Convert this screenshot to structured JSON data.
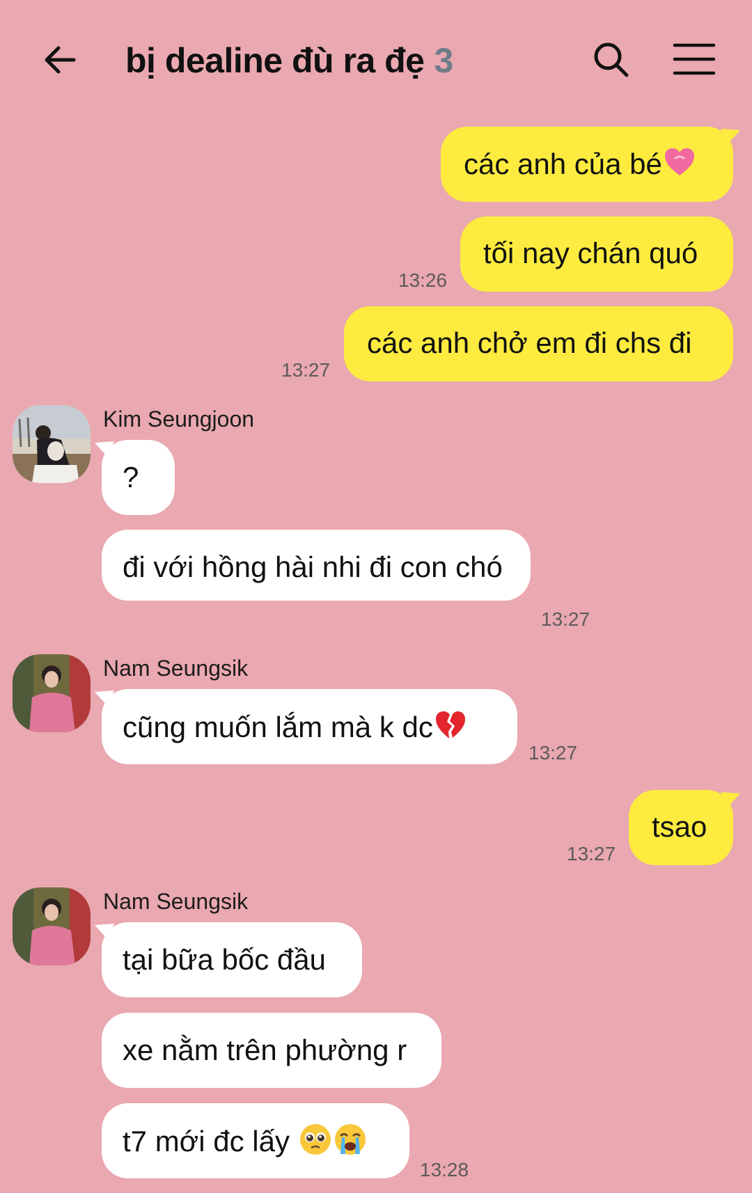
{
  "header": {
    "title": "bị dealine đù ra đẹ",
    "member_count": "3"
  },
  "messages": [
    {
      "from": "me",
      "text": "các anh của bé",
      "emoji": "pink-heart"
    },
    {
      "from": "me",
      "text": "tối nay chán quó",
      "time": "13:26"
    },
    {
      "from": "me",
      "text": "các anh chở em đi chs đi",
      "time": "13:27"
    },
    {
      "from": "them",
      "sender": "Kim Seungjoon",
      "text": "?"
    },
    {
      "from": "them",
      "text": "đi với hồng hài nhi đi con chó",
      "time": "13:27"
    },
    {
      "from": "them",
      "sender": "Nam Seungsik",
      "text": "cũng muốn lắm mà k dc",
      "emoji": "broken-heart",
      "time": "13:27"
    },
    {
      "from": "me",
      "text": "tsao",
      "time": "13:27"
    },
    {
      "from": "them",
      "sender": "Nam Seungsik",
      "text": "tại bữa bốc đầu"
    },
    {
      "from": "them",
      "text": "xe nằm trên phường r"
    },
    {
      "from": "them",
      "text": "t7 mới đc lấy",
      "emoji": "pleading-face, loudly-crying-face",
      "time": "13:28"
    }
  ],
  "colors": {
    "background": "#eaa8b0",
    "my_bubble": "#fdec3f",
    "their_bubble": "#ffffff",
    "member_count": "#6f7b88"
  },
  "icons": [
    "back-arrow-icon",
    "search-icon",
    "menu-icon"
  ]
}
